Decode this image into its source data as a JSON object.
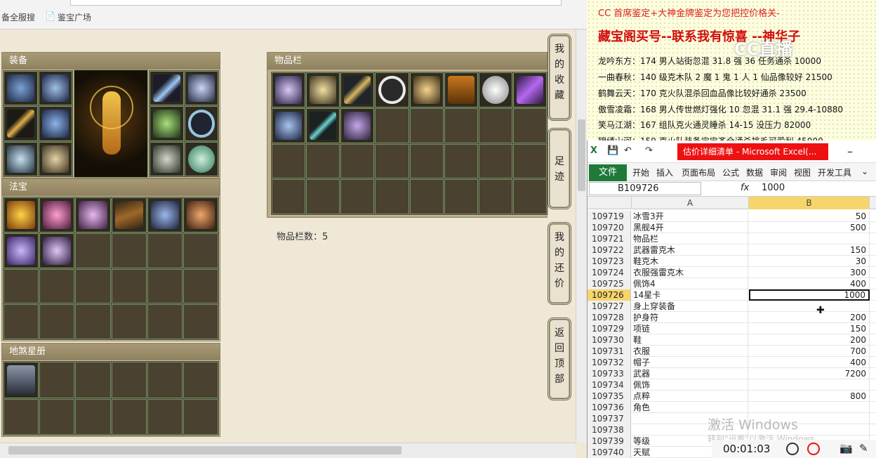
{
  "browser": {
    "bookmarks": [
      "备全服搜",
      "鉴宝广场"
    ]
  },
  "panels": {
    "equipment_title": "装备",
    "treasure_title": "法宝",
    "star_title": "地煞星册",
    "inventory_title": "物品栏",
    "item_count_label": "物品栏数：5"
  },
  "side_nav": [
    {
      "label": "我的收藏",
      "chars": [
        "我",
        "的",
        "收",
        "藏"
      ]
    },
    {
      "label": "足迹",
      "chars": [
        "足",
        "迹"
      ]
    },
    {
      "label": "我的还价",
      "chars": [
        "我",
        "的",
        "还",
        "价"
      ]
    },
    {
      "label": "返回顶部",
      "chars": [
        "返",
        "回",
        "顶",
        "部"
      ]
    }
  ],
  "notes": {
    "header": "CC 首席鉴定+大神金牌鉴定为您把控价格关-",
    "title": "藏宝阁买号--联系我有惊喜 --神华子",
    "logo": "CC直播",
    "lines": [
      "龙吟东方：174 男人站街忽混 31.8 强 36 任务通杀 10000",
      "一曲春秋：140 级克木队 2 魔 1 鬼 1 人 1 仙品像较好 21500",
      "鹤舞云天：170 克火队混杀回血品像比较好通杀 23500",
      "傲雪凌霜：168 男人传世燃灯强化 10 忽混 31.1 强 29.4-10880",
      "笑马江湖：167 组队克火通灵睡杀 14-15 没压力 82000",
      "锦绣山河：159 克火队装备宝宝齐全通杀挑毛可爱利 45000"
    ]
  },
  "excel": {
    "window_title": "估价详细清单 - Microsoft Excel(...",
    "file_tab": "文件",
    "tabs": [
      "开始",
      "插入",
      "页面布局",
      "公式",
      "数据",
      "审阅",
      "视图",
      "开发工具"
    ],
    "name_box": "B109726",
    "fx": "fx",
    "formula_value": "1000",
    "col_a": "A",
    "col_b": "B",
    "rows": [
      {
        "n": "109719",
        "a": "冰雪3开",
        "b": "50"
      },
      {
        "n": "109720",
        "a": "黑舰4开",
        "b": "500"
      },
      {
        "n": "109721",
        "a": "物品栏",
        "b": ""
      },
      {
        "n": "109722",
        "a": "武器雷克木",
        "b": "150"
      },
      {
        "n": "109723",
        "a": "鞋克木",
        "b": "30"
      },
      {
        "n": "109724",
        "a": "衣服强雷克木",
        "b": "300"
      },
      {
        "n": "109725",
        "a": "佩饰4",
        "b": "400"
      },
      {
        "n": "109726",
        "a": "14星卡",
        "b": "1000"
      },
      {
        "n": "109727",
        "a": "身上穿装备",
        "b": ""
      },
      {
        "n": "109728",
        "a": "护身符",
        "b": "200"
      },
      {
        "n": "109729",
        "a": "项链",
        "b": "150"
      },
      {
        "n": "109730",
        "a": "鞋",
        "b": "200"
      },
      {
        "n": "109731",
        "a": "衣服",
        "b": "700"
      },
      {
        "n": "109732",
        "a": "帽子",
        "b": "400"
      },
      {
        "n": "109733",
        "a": "武器",
        "b": "7200"
      },
      {
        "n": "109734",
        "a": "佩饰",
        "b": ""
      },
      {
        "n": "109735",
        "a": "点粹",
        "b": "800"
      },
      {
        "n": "109736",
        "a": "角色",
        "b": ""
      },
      {
        "n": "109737",
        "a": "",
        "b": ""
      },
      {
        "n": "109738",
        "a": "",
        "b": ""
      },
      {
        "n": "109739",
        "a": "等级",
        "b": ""
      },
      {
        "n": "109740",
        "a": "天赋",
        "b": ""
      }
    ]
  },
  "watermark": {
    "line1": "激活 Windows",
    "line2": "转到\"设置\"以激活 Windows。"
  },
  "recorder": {
    "time": "00:01:03"
  },
  "colors": {
    "excel_green": "#1f7a3a",
    "title_red": "#e11111",
    "selected_row": "#f6d56b"
  }
}
